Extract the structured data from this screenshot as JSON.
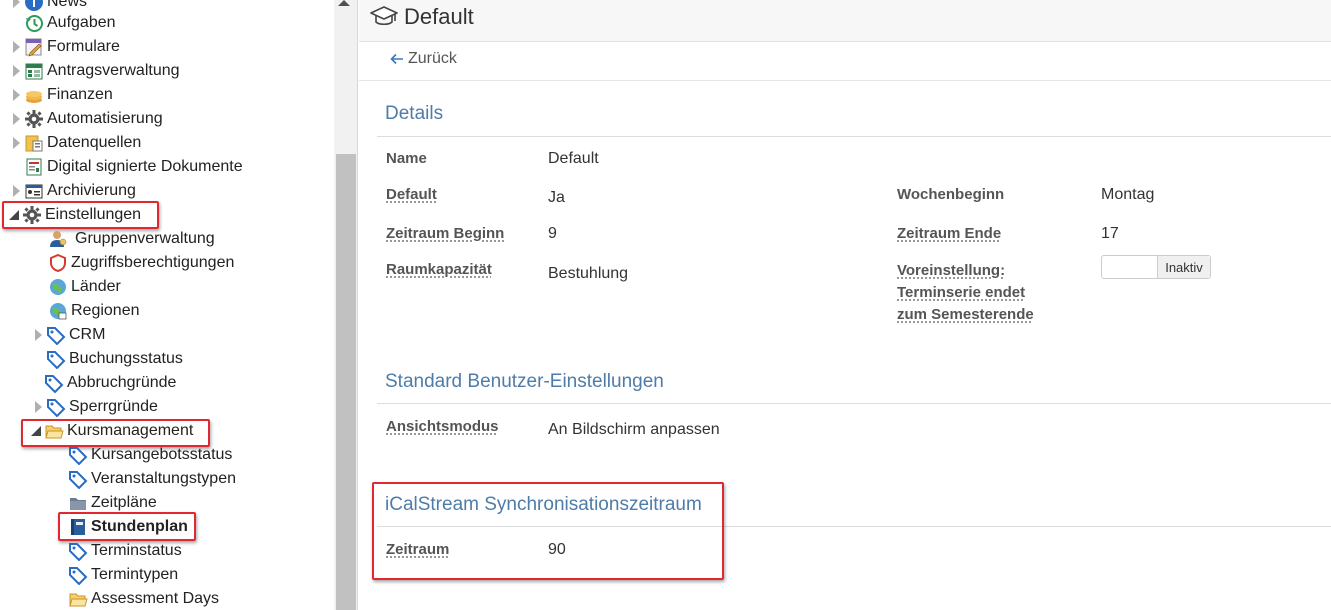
{
  "tree": {
    "items": [
      {
        "label": "News"
      },
      {
        "label": "Aufgaben"
      },
      {
        "label": "Formulare"
      },
      {
        "label": "Antragsverwaltung"
      },
      {
        "label": "Finanzen"
      },
      {
        "label": "Automatisierung"
      },
      {
        "label": "Datenquellen"
      },
      {
        "label": "Digital signierte Dokumente"
      },
      {
        "label": "Archivierung"
      },
      {
        "label": "Einstellungen"
      },
      {
        "label": "Gruppenverwaltung"
      },
      {
        "label": "Zugriffsberechtigungen"
      },
      {
        "label": "Länder"
      },
      {
        "label": "Regionen"
      },
      {
        "label": "CRM"
      },
      {
        "label": "Buchungsstatus"
      },
      {
        "label": "Abbruchgründe"
      },
      {
        "label": "Sperrgründe"
      },
      {
        "label": "Kursmanagement"
      },
      {
        "label": "Kursangebotsstatus"
      },
      {
        "label": "Veranstaltungstypen"
      },
      {
        "label": "Zeitpläne"
      },
      {
        "label": "Stundenplan"
      },
      {
        "label": "Terminstatus"
      },
      {
        "label": "Termintypen"
      },
      {
        "label": "Assessment Days"
      }
    ]
  },
  "header": {
    "title": "Default",
    "icon": "graduation-cap-icon"
  },
  "back": {
    "label": "Zurück"
  },
  "details": {
    "title": "Details",
    "name_label": "Name",
    "name_value": "Default",
    "default_label": "Default",
    "default_value": "Ja",
    "wochenbeginn_label": "Wochenbeginn",
    "wochenbeginn_value": "Montag",
    "zeitraum_beginn_label": "Zeitraum Beginn",
    "zeitraum_beginn_value": "9",
    "zeitraum_ende_label": "Zeitraum Ende",
    "zeitraum_ende_value": "17",
    "raumkapazitaet_label": "Raumkapazität",
    "raumkapazitaet_value": "Bestuhlung",
    "voreinstellung_label_1": "Voreinstellung:",
    "voreinstellung_label_2": "Terminserie endet",
    "voreinstellung_label_3": "zum Semesterende",
    "voreinstellung_toggle": "Inaktiv"
  },
  "benutzer": {
    "title": "Standard Benutzer-Einstellungen",
    "ansichtsmodus_label": "Ansichtsmodus",
    "ansichtsmodus_value": "An Bildschirm anpassen"
  },
  "ical": {
    "title": "iCalStream Synchronisationszeitraum",
    "zeitraum_label": "Zeitraum",
    "zeitraum_value": "90"
  },
  "colors": {
    "highlight": "#e0282e",
    "section_title": "#4e7ca8",
    "link": "#3a78c2"
  }
}
